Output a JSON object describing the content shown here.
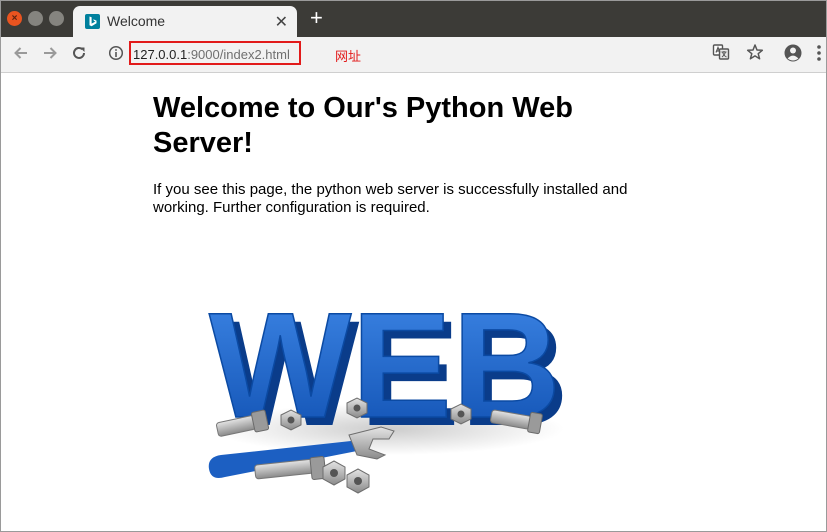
{
  "window": {
    "controls": [
      "close-icon",
      "minimize-icon",
      "maximize-icon"
    ]
  },
  "tab": {
    "title": "Welcome",
    "favicon": "bing-favicon",
    "close_glyph": "✕"
  },
  "new_tab_glyph": "+",
  "toolbar": {
    "icons": [
      "back-arrow-icon",
      "forward-arrow-icon",
      "reload-icon",
      "info-icon",
      "translate-icon",
      "star-icon",
      "profile-icon",
      "menu-icon"
    ]
  },
  "address": {
    "host": "127.0.0.1",
    "path": ":9000/index2.html",
    "annotation": "网址"
  },
  "page": {
    "heading": "Welcome to Our's Python Web Server!",
    "paragraph": "If you see this page, the python web server is successfully installed and working. Further configuration is required.",
    "image_text": "WEB"
  },
  "colors": {
    "titlebar": "#3c3b37",
    "close_button": "#e95420",
    "annotation_red": "#e21b1b",
    "web_blue": "#1c62c4"
  }
}
